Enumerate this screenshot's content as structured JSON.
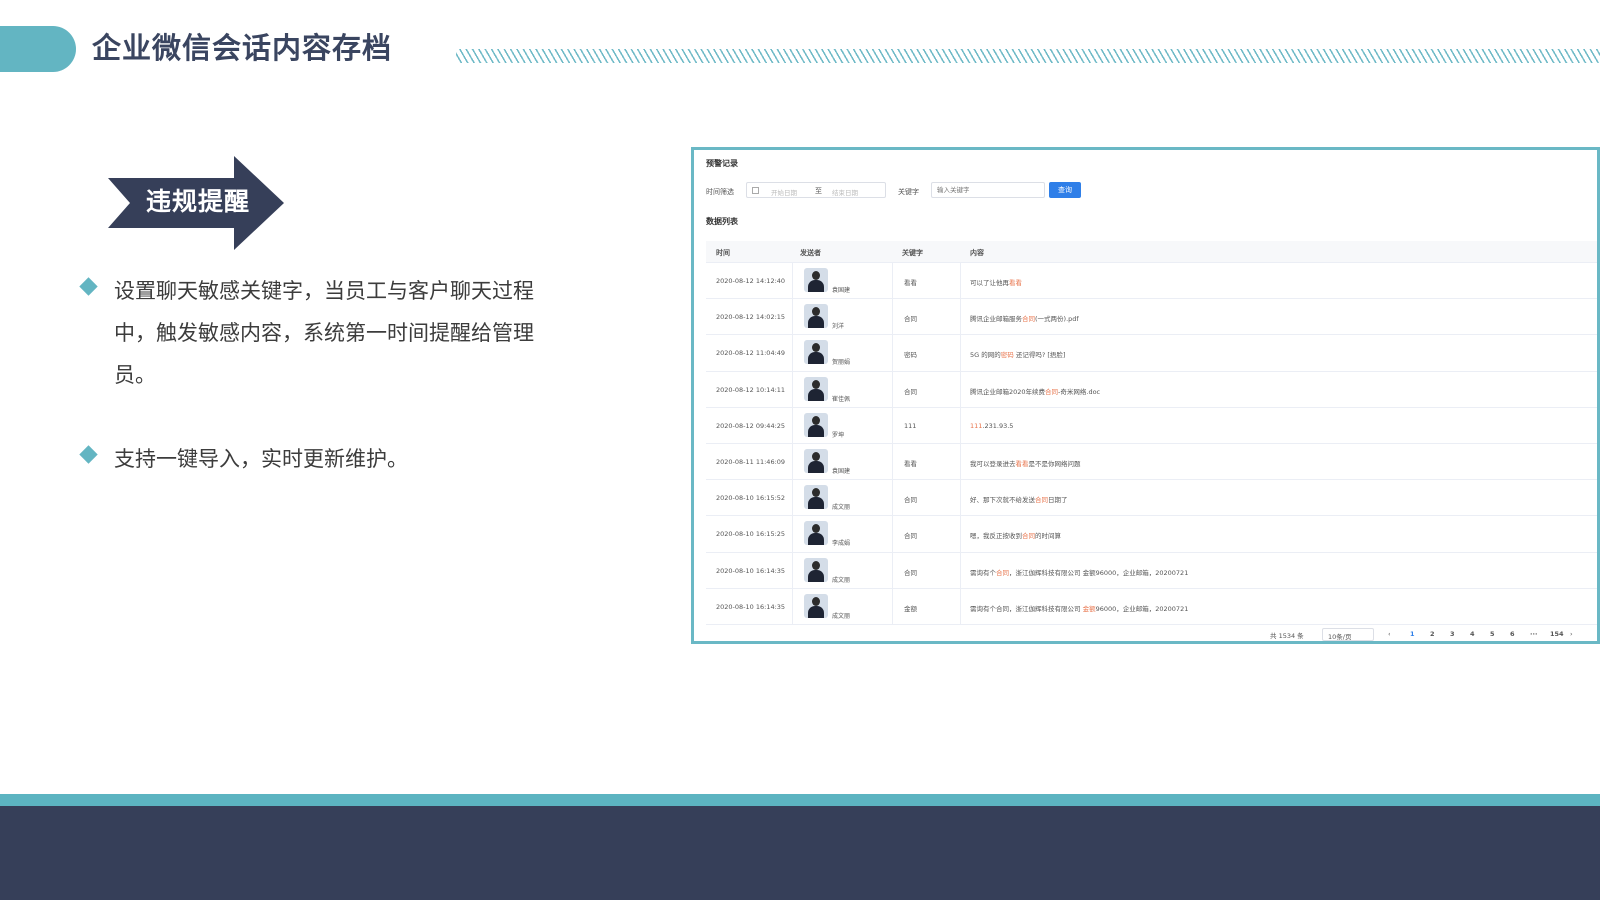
{
  "header": {
    "title": "企业微信会话内容存档"
  },
  "badge": {
    "label": "违规提醒"
  },
  "bullets": [
    "设置聊天敏感关键字，当员工与客户聊天过程中，触发敏感内容，系统第一时间提醒给管理员。",
    "支持一键导入，实时更新维护。"
  ],
  "screenshot": {
    "card_title": "预警记录",
    "filter": {
      "time_label": "时间筛选",
      "start_placeholder": "开始日期",
      "range_separator": "至",
      "end_placeholder": "结束日期",
      "keyword_label": "关键字",
      "keyword_placeholder": "输入关键字",
      "query_button": "查询"
    },
    "list_title": "数据列表",
    "columns": [
      "时间",
      "发送者",
      "关键字",
      "内容"
    ],
    "rows": [
      {
        "time": "2020-08-12 14:12:40",
        "sender": "袁国建",
        "keyword": "看看",
        "content_pre": "可以了让他再",
        "content_hl": "看看",
        "content_post": ""
      },
      {
        "time": "2020-08-12 14:02:15",
        "sender": "刘洋",
        "keyword": "合同",
        "content_pre": "腾讯企业邮箱服务",
        "content_hl": "合同",
        "content_post": "(一式两份).pdf"
      },
      {
        "time": "2020-08-12 11:04:49",
        "sender": "贺丽娟",
        "keyword": "密码",
        "content_pre": "5G 的网的",
        "content_hl": "密码",
        "content_post": " 还记得吗? [捂脸]"
      },
      {
        "time": "2020-08-12 10:14:11",
        "sender": "崔佳佩",
        "keyword": "合同",
        "content_pre": "腾讯企业邮箱2020年续费",
        "content_hl": "合同",
        "content_post": "-奇米网络.doc"
      },
      {
        "time": "2020-08-12 09:44:25",
        "sender": "罗坤",
        "keyword": "111",
        "content_pre": "",
        "content_hl": "111",
        "content_post": ".231.93.5"
      },
      {
        "time": "2020-08-11 11:46:09",
        "sender": "袁国建",
        "keyword": "看看",
        "content_pre": "我可以登录进去",
        "content_hl": "看看",
        "content_post": "是不是你网络问题"
      },
      {
        "time": "2020-08-10 16:15:52",
        "sender": "成文丽",
        "keyword": "合同",
        "content_pre": "好、那下次就不给发送",
        "content_hl": "合同",
        "content_post": "日期了"
      },
      {
        "time": "2020-08-10 16:15:25",
        "sender": "李成娟",
        "keyword": "合同",
        "content_pre": "嗯，我反正按收到",
        "content_hl": "合同",
        "content_post": "的时间算"
      },
      {
        "time": "2020-08-10 16:14:35",
        "sender": "成文丽",
        "keyword": "合同",
        "content_pre": "需询有个",
        "content_hl": "合同",
        "content_post": "，浙江伽辉科技有限公司 金额96000，企业邮箱，20200721"
      },
      {
        "time": "2020-08-10 16:14:35",
        "sender": "成文丽",
        "keyword": "金额",
        "content_pre": "需询有个合同，浙江伽辉科技有限公司 ",
        "content_hl": "金额",
        "content_post": "96000，企业邮箱，20200721"
      }
    ],
    "pagination": {
      "total": "共 1534 条",
      "page_size": "10条/页",
      "prev": "‹",
      "pages": [
        "1",
        "2",
        "3",
        "4",
        "5",
        "6",
        "···",
        "154"
      ],
      "next": "›",
      "current": "1"
    },
    "colors": {
      "highlight": "#e8734a",
      "primary": "#2f7fe8",
      "frame": "#6ab8c5"
    }
  },
  "colors": {
    "accent": "#63b5c2",
    "navy": "#363f59"
  }
}
